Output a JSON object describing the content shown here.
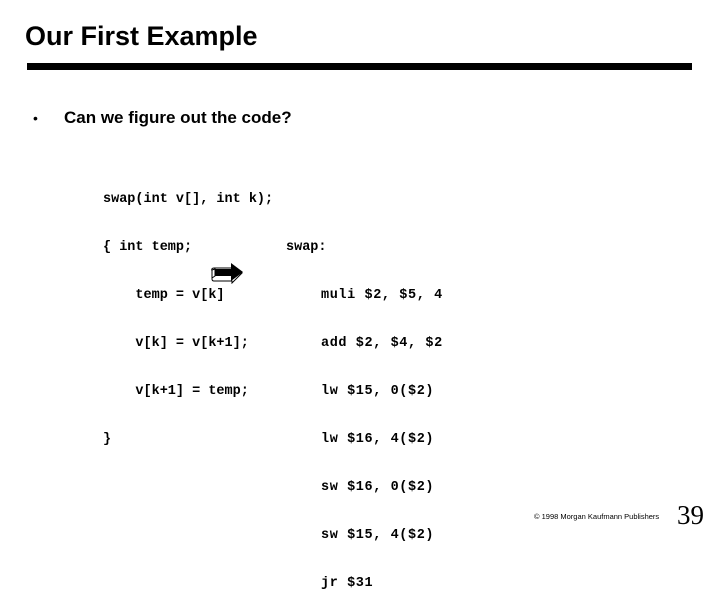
{
  "slide": {
    "title": "Our First Example",
    "bullet": {
      "marker": "•",
      "text": "Can we figure out the code?"
    },
    "c_code": {
      "language": "C",
      "lines": [
        "swap(int v[], int k);",
        "{ int temp;",
        "    temp = v[k]",
        "    v[k] = v[k+1];",
        "    v[k+1] = temp;",
        "}"
      ]
    },
    "arrow_icon": "right-arrow-icon",
    "asm_code": {
      "language": "MIPS assembly",
      "label": "swap:",
      "lines": [
        "muli $2, $5, 4",
        "add $2, $4, $2",
        "lw $15, 0($2)",
        "lw $16, 4($2)",
        "sw $16, 0($2)",
        "sw $15, 4($2)",
        "jr $31"
      ]
    },
    "footer": {
      "copyright": "© 1998 Morgan Kaufmann Publishers",
      "page_number": "39"
    }
  }
}
